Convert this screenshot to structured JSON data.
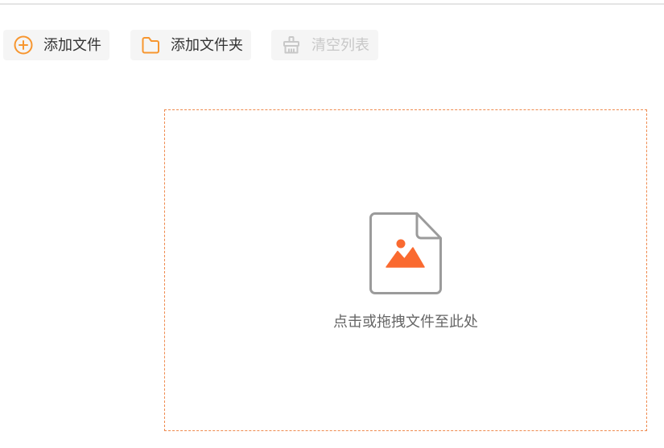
{
  "toolbar": {
    "add_file": {
      "label": "添加文件",
      "icon": "plus-circle-icon"
    },
    "add_folder": {
      "label": "添加文件夹",
      "icon": "folder-icon"
    },
    "clear_list": {
      "label": "清空列表",
      "icon": "broom-icon",
      "disabled": true
    }
  },
  "dropzone": {
    "icon": "image-file-icon",
    "hint": "点击或拖拽文件至此处"
  },
  "colors": {
    "accent": "#f7962f",
    "image_accent": "#fa6a30",
    "dropzone_border": "#ef8a4e",
    "disabled": "#c8c8c8",
    "text": "#333333",
    "hint_text": "#666666"
  }
}
